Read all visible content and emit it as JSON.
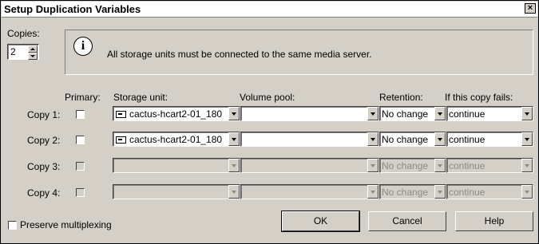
{
  "window": {
    "title": "Setup Duplication Variables",
    "close_glyph": "×"
  },
  "copies": {
    "label": "Copies:",
    "value": "2"
  },
  "info": {
    "icon": "info-icon",
    "message": "All storage units must be connected to the same media server."
  },
  "headers": {
    "primary": "Primary:",
    "storage_unit": "Storage unit:",
    "volume_pool": "Volume pool:",
    "retention": "Retention:",
    "on_fail": "If this copy fails:"
  },
  "rows": [
    {
      "label": "Copy 1:",
      "storage_unit": "cactus-hcart2-01_180",
      "volume_pool": "",
      "retention": "No change",
      "on_fail": "continue",
      "enabled": true
    },
    {
      "label": "Copy 2:",
      "storage_unit": "cactus-hcart2-01_180",
      "volume_pool": "",
      "retention": "No change",
      "on_fail": "continue",
      "enabled": true
    },
    {
      "label": "Copy 3:",
      "storage_unit": "",
      "volume_pool": "",
      "retention": "No change",
      "on_fail": "continue",
      "enabled": false
    },
    {
      "label": "Copy 4:",
      "storage_unit": "",
      "volume_pool": "",
      "retention": "No change",
      "on_fail": "continue",
      "enabled": false
    }
  ],
  "preserve_multiplexing": {
    "label": "Preserve multiplexing",
    "checked": false
  },
  "buttons": {
    "ok": "OK",
    "cancel": "Cancel",
    "help": "Help"
  }
}
